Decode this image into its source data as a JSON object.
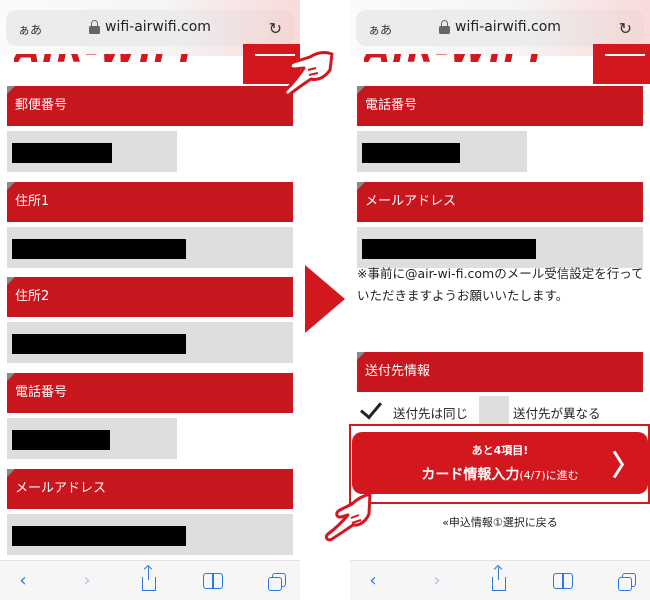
{
  "browser": {
    "text_size_label": "ぁあ",
    "url": "wifi-airwifi.com",
    "reload_icon": "reload-icon",
    "toolbar_icons": [
      "back-icon",
      "forward-icon",
      "share-icon",
      "bookmarks-icon",
      "tabs-icon"
    ]
  },
  "site": {
    "logo": "AIR-WIFI",
    "brand_color": "#d3171f"
  },
  "left_form": {
    "fields": [
      {
        "label": "郵便番号"
      },
      {
        "label": "住所1"
      },
      {
        "label": "住所2"
      },
      {
        "label": "電話番号"
      },
      {
        "label": "メールアドレス"
      }
    ]
  },
  "right_form": {
    "fields": [
      {
        "label": "電話番号"
      },
      {
        "label": "メールアドレス"
      }
    ],
    "email_note": "※事前に@air-wi-fi.comのメール受信設定を行っていただきますようお願いいたします。",
    "shipping_section": "送付先情報",
    "options": [
      {
        "label": "送付先は同じ",
        "checked": true
      },
      {
        "label": "送付先が異なる",
        "checked": false
      }
    ],
    "cta": {
      "remaining": "あと4項目!",
      "main": "カード情報入力",
      "step": "(4/7)",
      "suffix": "に進む",
      "arrow": "〉"
    },
    "back_link": "«申込情報①選択に戻る"
  }
}
